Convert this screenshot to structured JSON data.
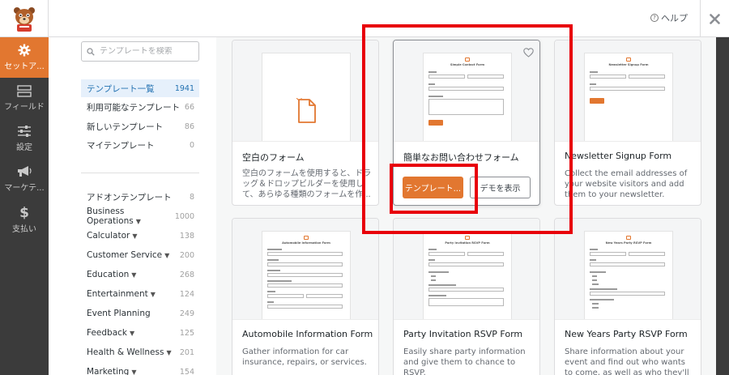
{
  "header": {
    "help_label": "ヘルプ",
    "help_icon": "question-circle-icon",
    "close_icon": "close-x-icon"
  },
  "left_nav": {
    "items": [
      {
        "label": "セットア...",
        "icon": "gear-icon",
        "active": true
      },
      {
        "label": "フィールド",
        "icon": "fields-icon",
        "active": false
      },
      {
        "label": "設定",
        "icon": "sliders-icon",
        "active": false
      },
      {
        "label": "マーケテ...",
        "icon": "megaphone-icon",
        "active": false
      },
      {
        "label": "支払い",
        "icon": "dollar-icon",
        "active": false
      }
    ]
  },
  "search": {
    "placeholder": "テンプレートを検索"
  },
  "categories": [
    {
      "label": "テンプレート一覧",
      "count": "1941",
      "active": true,
      "dropdown": false
    },
    {
      "label": "利用可能なテンプレート",
      "count": "66",
      "active": false,
      "dropdown": false
    },
    {
      "label": "新しいテンプレート",
      "count": "86",
      "active": false,
      "dropdown": false
    },
    {
      "label": "マイテンプレート",
      "count": "0",
      "active": false,
      "dropdown": false
    },
    {
      "label": "アドオンテンプレート",
      "count": "8",
      "active": false,
      "dropdown": false
    },
    {
      "label": "Business Operations",
      "count": "1000",
      "active": false,
      "dropdown": true
    },
    {
      "label": "Calculator",
      "count": "138",
      "active": false,
      "dropdown": true
    },
    {
      "label": "Customer Service",
      "count": "200",
      "active": false,
      "dropdown": true
    },
    {
      "label": "Education",
      "count": "268",
      "active": false,
      "dropdown": true
    },
    {
      "label": "Entertainment",
      "count": "124",
      "active": false,
      "dropdown": true
    },
    {
      "label": "Event Planning",
      "count": "249",
      "active": false,
      "dropdown": false
    },
    {
      "label": "Feedback",
      "count": "125",
      "active": false,
      "dropdown": true
    },
    {
      "label": "Health & Wellness",
      "count": "201",
      "active": false,
      "dropdown": true
    },
    {
      "label": "Marketing",
      "count": "154",
      "active": false,
      "dropdown": true
    }
  ],
  "templates": [
    {
      "title": "空白のフォーム",
      "desc": "空白のフォームを使用すると、ドラッグ＆ドロップビルダーを使用して、あらゆる種類のフォームを作...",
      "kind": "blank"
    },
    {
      "title": "簡単なお問い合わせフォーム",
      "preview_title": "Simple Contact Form",
      "kind": "contact",
      "favorite_icon": "heart-outline-icon",
      "use_label": "テンプレート...",
      "demo_label": "デモを表示"
    },
    {
      "title": "Newsletter Signup Form",
      "preview_title": "Newsletter Signup Form",
      "desc": "Collect the email addresses of your website visitors and add them to your newsletter.",
      "kind": "newsletter"
    },
    {
      "title": "Automobile Information Form",
      "preview_title": "Automobile Information Form",
      "desc": "Gather information for car insurance, repairs, or services.",
      "kind": "auto"
    },
    {
      "title": "Party Invitation RSVP Form",
      "preview_title": "Party Invitation RSVP Form",
      "desc": "Easily share party information and give them to chance to RSVP.",
      "kind": "party"
    },
    {
      "title": "New Years Party RSVP Form",
      "preview_title": "New Years Party RSVP Form",
      "desc": "Share information about your event and find out who wants to come, as well as who they'll be bringing.",
      "kind": "newyears"
    }
  ],
  "colors": {
    "accent": "#e27730",
    "nav_bg": "#3b3b3b",
    "annotation_red": "#e8000a",
    "active_category": "#2271b1"
  }
}
